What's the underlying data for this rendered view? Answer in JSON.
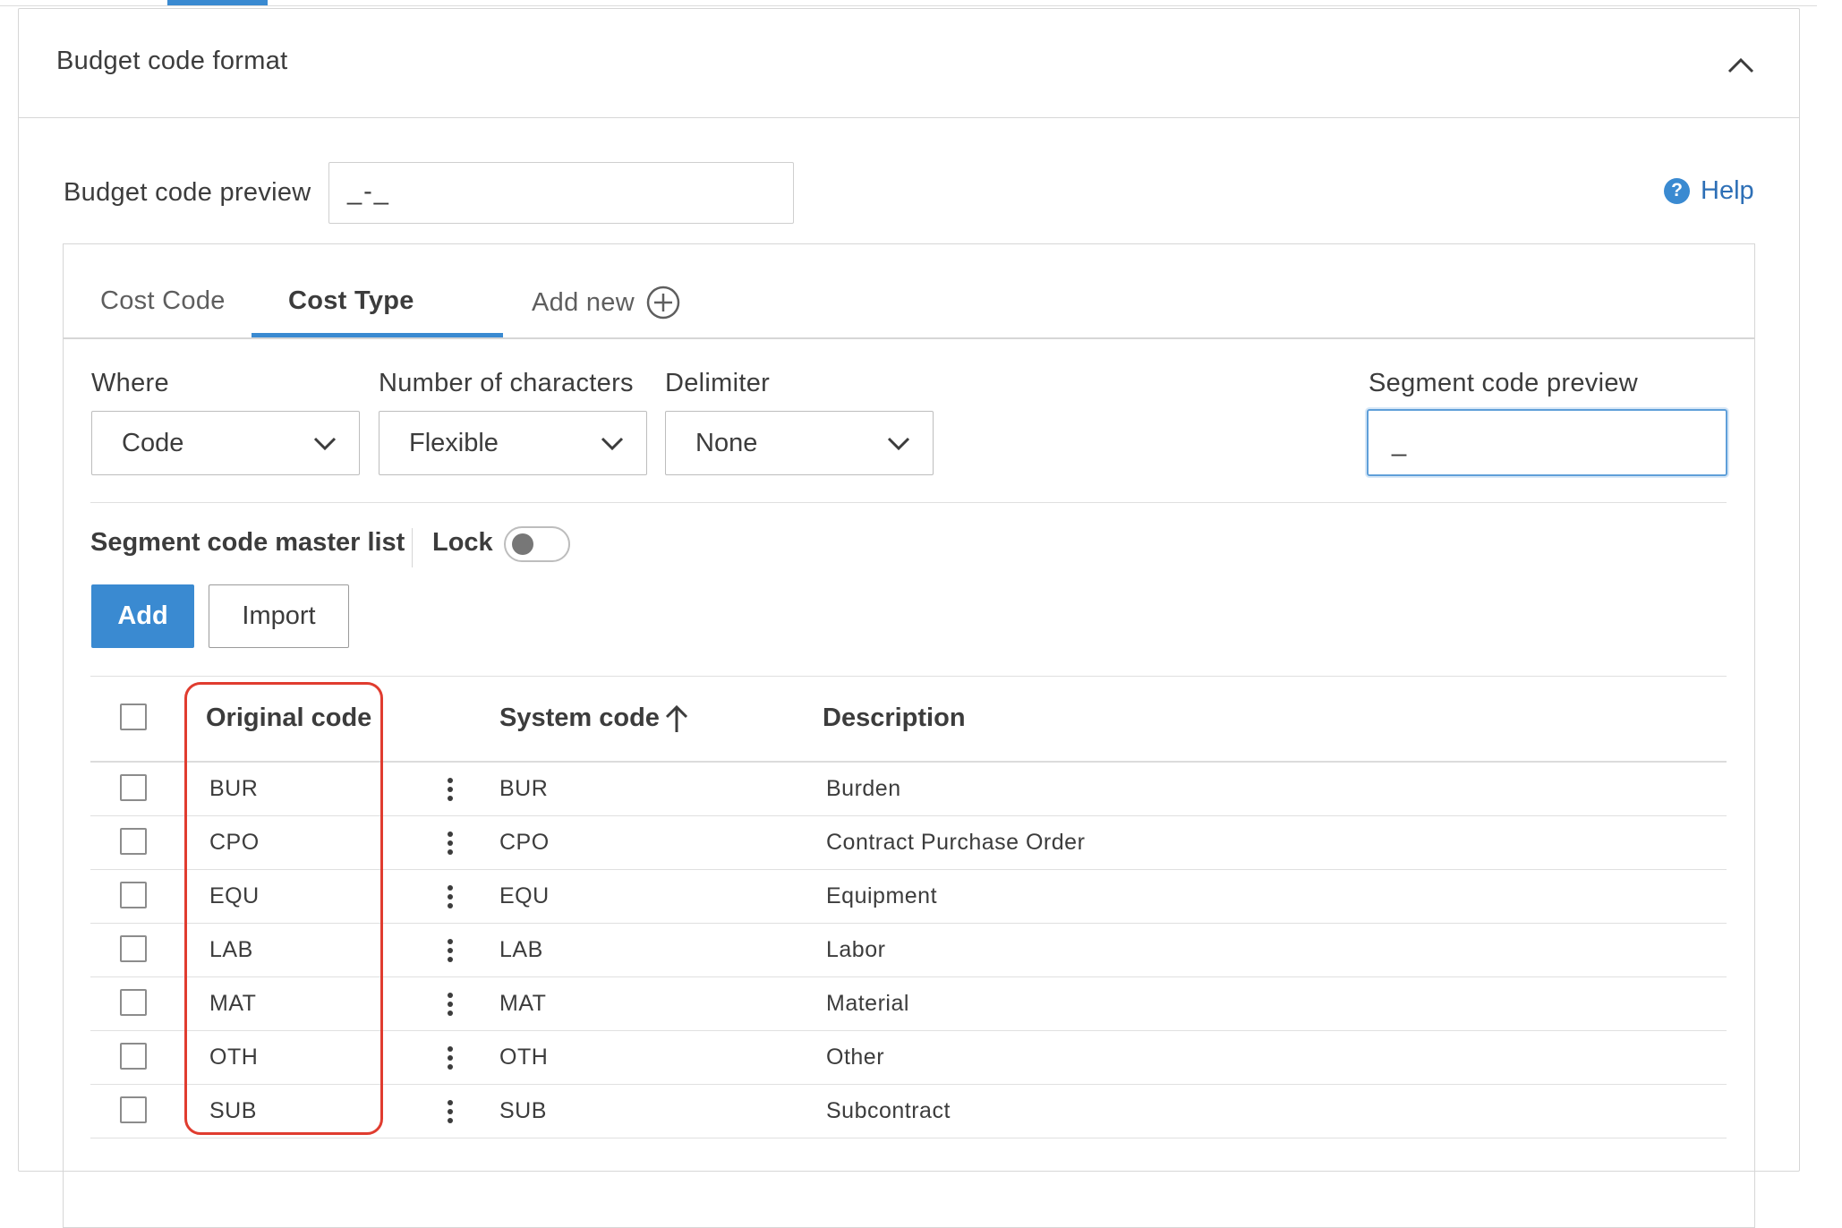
{
  "panel": {
    "title": "Budget code format"
  },
  "preview": {
    "label": "Budget code preview",
    "value": "_-_"
  },
  "help": {
    "label": "Help"
  },
  "tabs": [
    {
      "label": "Cost Code",
      "active": false
    },
    {
      "label": "Cost Type",
      "active": true
    }
  ],
  "add_new": {
    "label": "Add new"
  },
  "fields": {
    "where": {
      "label": "Where",
      "value": "Code"
    },
    "num_chars": {
      "label": "Number of characters",
      "value": "Flexible"
    },
    "delimiter": {
      "label": "Delimiter",
      "value": "None"
    },
    "segment_preview": {
      "label": "Segment code preview",
      "value": "_"
    }
  },
  "master_list": {
    "label": "Segment code master list",
    "lock_label": "Lock",
    "lock_on": false
  },
  "buttons": {
    "add": "Add",
    "import": "Import"
  },
  "table": {
    "headers": {
      "original": "Original code",
      "system": "System code",
      "description": "Description"
    },
    "sort": {
      "column": "system",
      "direction": "ascending"
    },
    "rows": [
      {
        "original": "BUR",
        "system": "BUR",
        "description": "Burden"
      },
      {
        "original": "CPO",
        "system": "CPO",
        "description": "Contract Purchase Order"
      },
      {
        "original": "EQU",
        "system": "EQU",
        "description": "Equipment"
      },
      {
        "original": "LAB",
        "system": "LAB",
        "description": "Labor"
      },
      {
        "original": "MAT",
        "system": "MAT",
        "description": "Material"
      },
      {
        "original": "OTH",
        "system": "OTH",
        "description": "Other"
      },
      {
        "original": "SUB",
        "system": "SUB",
        "description": "Subcontract"
      }
    ]
  },
  "colors": {
    "accent": "#3a8ad1",
    "highlight": "#e03c2f",
    "link": "#2d6fb6"
  }
}
